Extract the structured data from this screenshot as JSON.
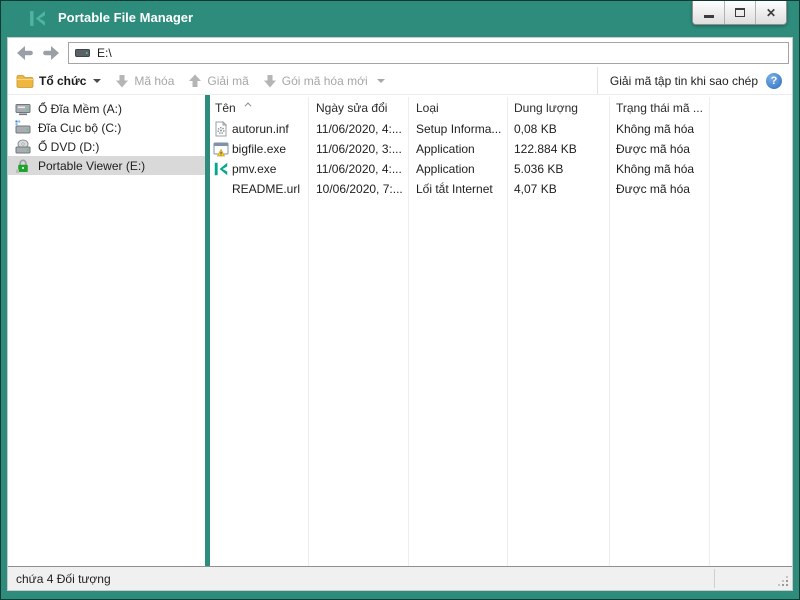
{
  "window": {
    "title": "Portable File Manager"
  },
  "window_controls": {
    "minimize": "minimize",
    "maximize": "maximize",
    "close": "close"
  },
  "nav": {
    "address": "E:\\"
  },
  "toolbar": {
    "organize": "Tổ chức",
    "encrypt": "Mã hóa",
    "decrypt": "Giải mã",
    "new_package": "Gói mã hóa mới",
    "decrypt_on_copy": "Giải mã tập tin khi sao chép",
    "help_glyph": "?"
  },
  "sidebar": {
    "items": [
      {
        "label": "Ổ Đĩa Mềm (A:)",
        "icon": "floppy-drive-icon",
        "selected": false
      },
      {
        "label": "Đĩa Cục bộ (C:)",
        "icon": "local-disk-icon",
        "selected": false
      },
      {
        "label": "Ổ DVD (D:)",
        "icon": "dvd-drive-icon",
        "selected": false
      },
      {
        "label": "Portable Viewer (E:)",
        "icon": "lock-icon",
        "selected": true
      }
    ]
  },
  "filelist": {
    "columns": [
      "Tên",
      "Ngày sửa đổi",
      "Loại",
      "Dung lượng",
      "Trạng thái mã ..."
    ],
    "rows": [
      {
        "icon": "setup-file-icon",
        "name": "autorun.inf",
        "modified": "11/06/2020, 4:...",
        "type": "Setup Informa...",
        "size": "0,08 KB",
        "status": "Không mã hóa"
      },
      {
        "icon": "exe-file-icon",
        "name": "bigfile.exe",
        "modified": "11/06/2020, 3:...",
        "type": "Application",
        "size": "122.884 KB",
        "status": "Được mã hóa"
      },
      {
        "icon": "kaspersky-icon",
        "name": "pmv.exe",
        "modified": "11/06/2020, 4:...",
        "type": "Application",
        "size": "5.036 KB",
        "status": "Không mã hóa"
      },
      {
        "icon": "no-icon",
        "name": "README.url",
        "modified": "10/06/2020, 7:...",
        "type": "Lối tắt Internet",
        "size": "4,07 KB",
        "status": "Được mã hóa"
      }
    ]
  },
  "statusbar": {
    "text": "chứa 4 Đối tượng"
  },
  "colors": {
    "titlebar_teal": "#2E8C7D",
    "kaspersky_logo_teal": "#4FB5A3",
    "kaspersky_brand_teal": "#00A88E",
    "lock_green": "#1FA32B",
    "folder_yellow": "#EFB73E",
    "help_blue": "#3D77C9",
    "selected_item_gray": "#D9D9D9"
  }
}
